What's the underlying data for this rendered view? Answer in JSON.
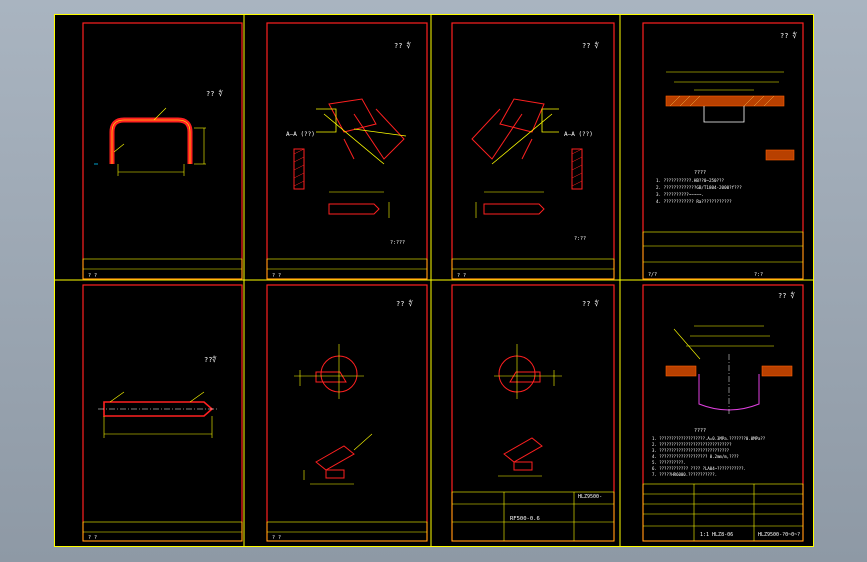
{
  "panels": {
    "p1": {
      "roughness": "?? ∜"
    },
    "p2": {
      "roughness": "?? ∜",
      "section": "A—A (??)",
      "scale": "?:???"
    },
    "p3": {
      "roughness": "?? ∜",
      "section": "A—A (??)",
      "scale": "?:??"
    },
    "p4": {
      "roughness": "?? ∜",
      "title": "????",
      "notes": [
        "1. ???????????.HB??0~250???",
        "2. ?????????????GB/T1804-2000?f???",
        "3. ??????????~~~~~.",
        "4. ???????????? Ra????????????"
      ]
    },
    "p5": {
      "roughness": "??∜"
    },
    "p6": {
      "roughness": "?? ∜"
    },
    "p7": {
      "roughness": "?? ∜",
      "part_no": "RF500-0.6",
      "doc_no": "HLZ9500-"
    },
    "p8": {
      "roughness": "?? ∜",
      "title": "????",
      "notes": [
        "1. ???????????????????.A=0.3MPa.???????0.0MPa??",
        "2. ??????????????????????????????",
        "3. ?????????????????????????????",
        "4. ???????????????????? 0.2mm/m,????",
        "5. ??????????.",
        "6. ???????????? ???? ?LA04~???????????.",
        "7. ?????HR6000.???????????."
      ],
      "doc_no": "1:1 HLZ8-06",
      "doc_no2": "HLZ9500-?0~0~?"
    }
  },
  "title_block": {
    "cell": "? ?",
    "weight": "?/?",
    "scale": "?:?"
  }
}
